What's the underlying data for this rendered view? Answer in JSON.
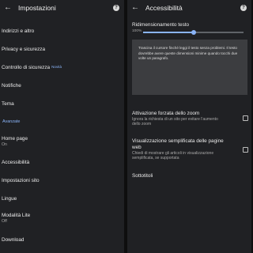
{
  "left": {
    "title": "Impostazioni",
    "items": [
      {
        "label": "Indirizzi e altro"
      },
      {
        "label": "Privacy e sicurezza"
      },
      {
        "label": "Controllo di sicurezza",
        "badge": "Novità"
      },
      {
        "label": "Notifiche"
      },
      {
        "label": "Tema"
      },
      {
        "label": "Home page",
        "sub": "On"
      },
      {
        "label": "Accessibilità"
      },
      {
        "label": "Impostazioni sito"
      },
      {
        "label": "Lingue"
      },
      {
        "label": "Modalità Lite",
        "sub": "Off"
      },
      {
        "label": "Download"
      }
    ],
    "section_label": "Avanzate"
  },
  "right": {
    "title": "Accessibilità",
    "text_scaling": {
      "label": "Ridimensionamento testo",
      "value": "100%",
      "fraction": 0.5
    },
    "preview_text": "Trascina il cursore finché leggi il testo senza problemi. Il testo dovrebbe avere queste dimensioni minime quando tocchi due volte un paragrafo.",
    "force_zoom": {
      "label": "Attivazione forzata dello zoom",
      "sub": "Ignora la richiesta di un sito per evitare l'aumento dello zoom"
    },
    "simplified_view": {
      "label": "Visualizzazione semplificata delle pagine web",
      "sub": "Chiedi di mostrare gli articoli in visualizzazione semplificata, se supportata"
    },
    "captions": {
      "label": "Sottotitoli"
    }
  }
}
